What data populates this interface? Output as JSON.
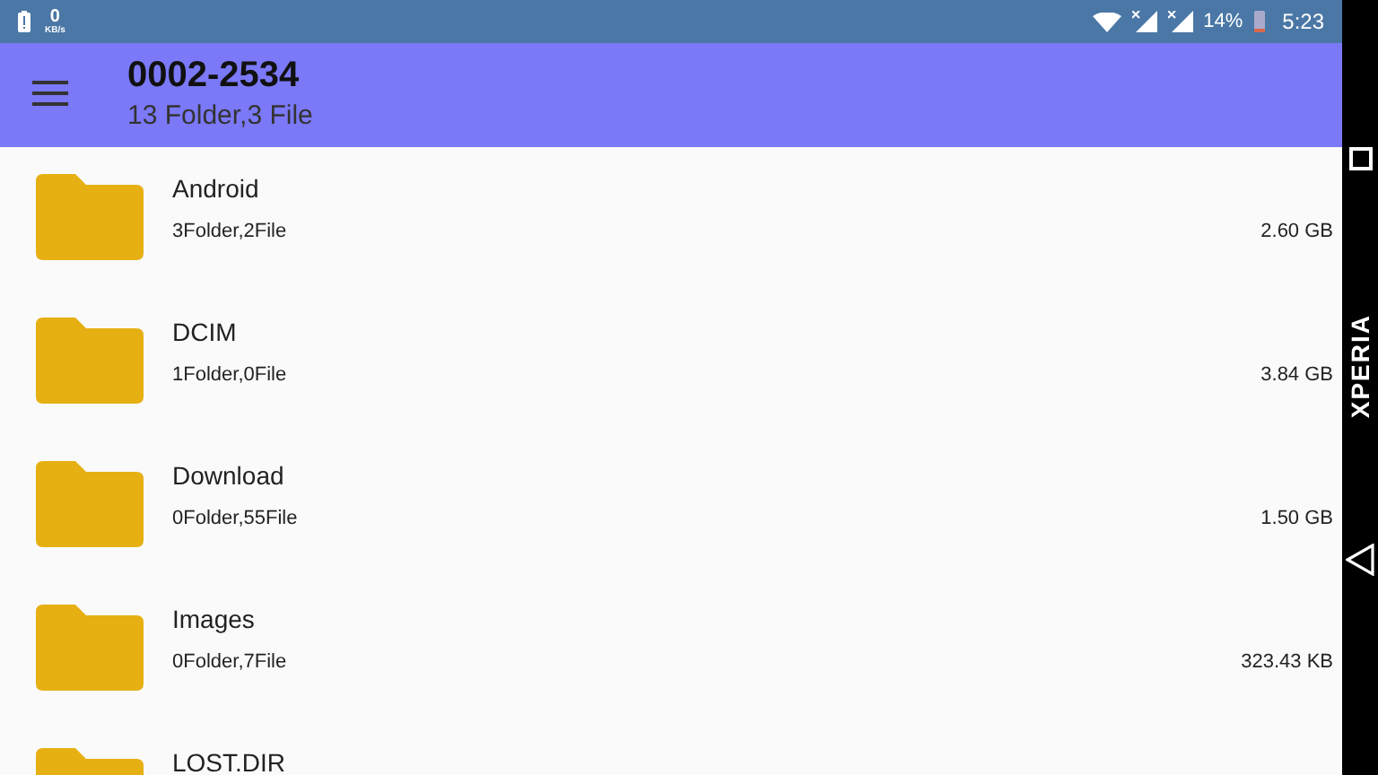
{
  "status_bar": {
    "network_speed": "0",
    "speed_unit": "KB/s",
    "battery": "14%",
    "time": "5:23"
  },
  "header": {
    "title": "0002-2534",
    "subtitle": "13 Folder,3 File"
  },
  "folders": [
    {
      "name": "Android",
      "contents": "3Folder,2File",
      "size": "2.60 GB"
    },
    {
      "name": "DCIM",
      "contents": "1Folder,0File",
      "size": "3.84 GB"
    },
    {
      "name": "Download",
      "contents": "0Folder,55File",
      "size": "1.50 GB"
    },
    {
      "name": "Images",
      "contents": "0Folder,7File",
      "size": "323.43 KB"
    },
    {
      "name": "LOST.DIR"
    }
  ],
  "nav_bar": {
    "brand": "XPERIA"
  }
}
